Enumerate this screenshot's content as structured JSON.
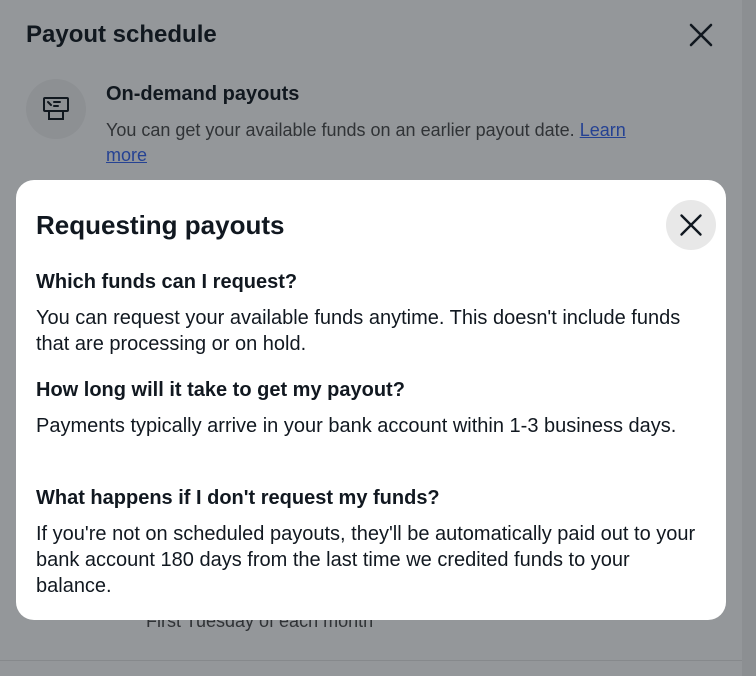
{
  "background": {
    "title": "Payout schedule",
    "feature": {
      "icon": "payout-register-icon",
      "title": "On-demand payouts",
      "description": "You can get your available funds on an earlier payout date.",
      "link_label": "Learn more"
    },
    "schedule_text": "First Tuesday of each month"
  },
  "dialog": {
    "title": "Requesting payouts",
    "close_icon": "close-icon",
    "faqs": [
      {
        "question": "Which funds can I request?",
        "answer": "You can request your available funds anytime. This doesn't include funds that are processing or on hold."
      },
      {
        "question": "How long will it take to get my payout?",
        "answer": "Payments typically arrive in your bank account within 1-3 business days."
      },
      {
        "question": "What happens if I don't request my funds?",
        "answer": "If you're not on scheduled payouts, they'll be automatically paid out to your bank account 180 days from the last time we credited funds to your balance."
      }
    ]
  },
  "colors": {
    "link": "#3665f3",
    "text": "#111820",
    "scrim": "#111820"
  }
}
